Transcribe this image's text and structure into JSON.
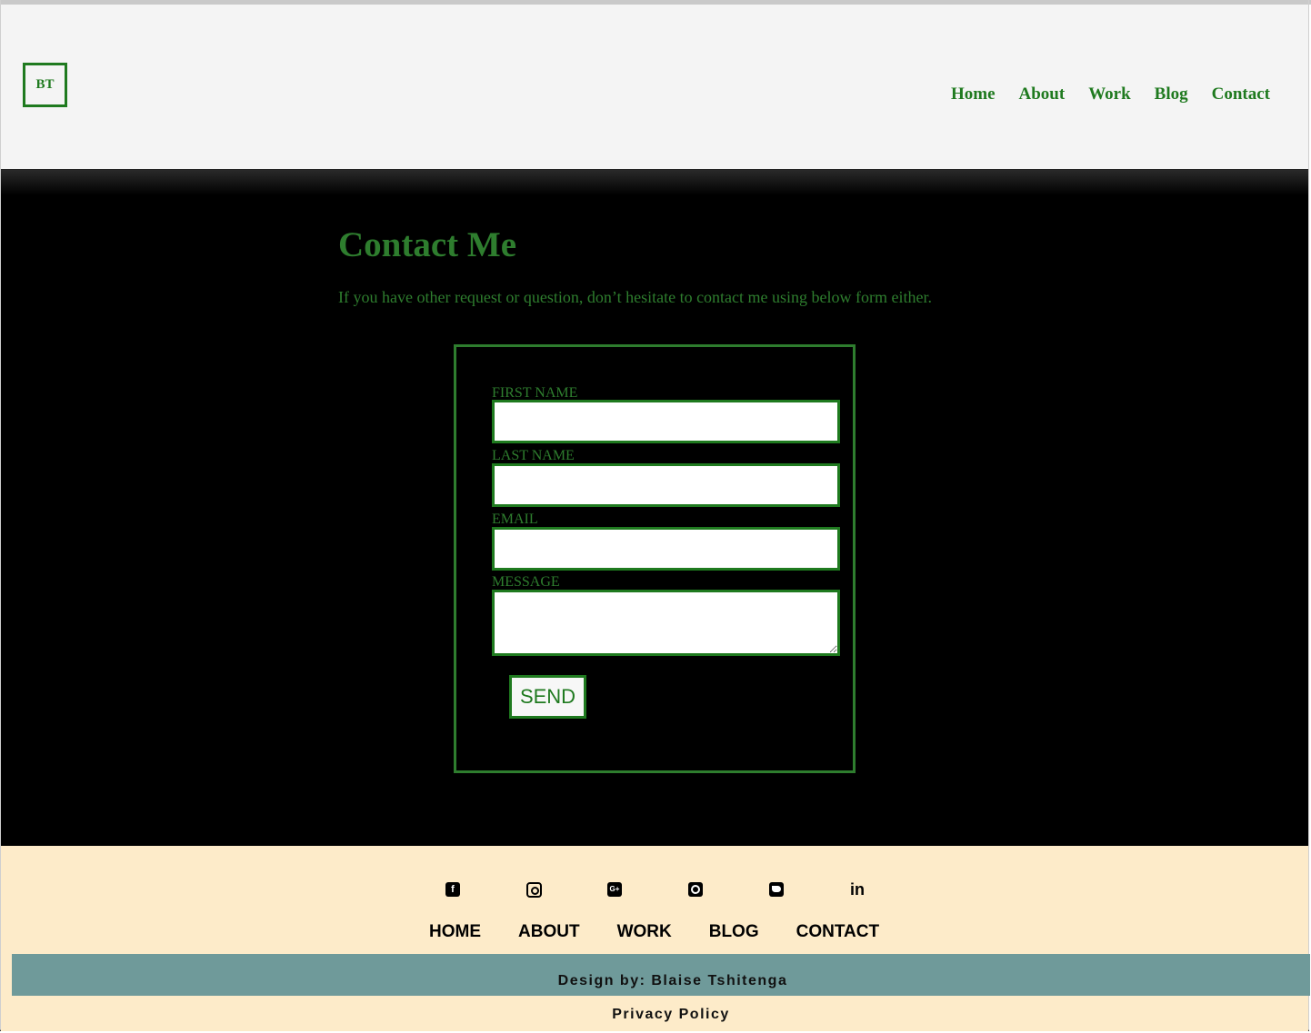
{
  "header": {
    "logo_text": "BT",
    "nav": [
      "Home",
      "About",
      "Work",
      "Blog",
      "Contact"
    ]
  },
  "main": {
    "title": "Contact Me",
    "intro": "If you have other request or question, don’t hesitate to contact me using below form either.",
    "form": {
      "first_name_label": "FIRST NAME",
      "first_name_value": "",
      "last_name_label": "LAST NAME",
      "last_name_value": "",
      "email_label": "EMAIL",
      "email_value": "",
      "message_label": "MESSAGE",
      "message_value": "",
      "send_label": "SEND"
    }
  },
  "footer": {
    "social_icons": [
      "facebook-icon",
      "instagram-icon",
      "google-plus-icon",
      "github-icon",
      "twitter-icon",
      "linkedin-icon"
    ],
    "nav": [
      "HOME",
      "ABOUT",
      "WORK",
      "BLOG",
      "CONTACT"
    ],
    "credit": "Design by: Blaise Tshitenga",
    "privacy": "Privacy Policy"
  },
  "colors": {
    "accent_green": "#1f7a1f",
    "header_bg": "#f4f4f4",
    "main_bg": "#000000",
    "footer_bg": "#fdebc9",
    "credit_bar": "#6f9a9a"
  }
}
